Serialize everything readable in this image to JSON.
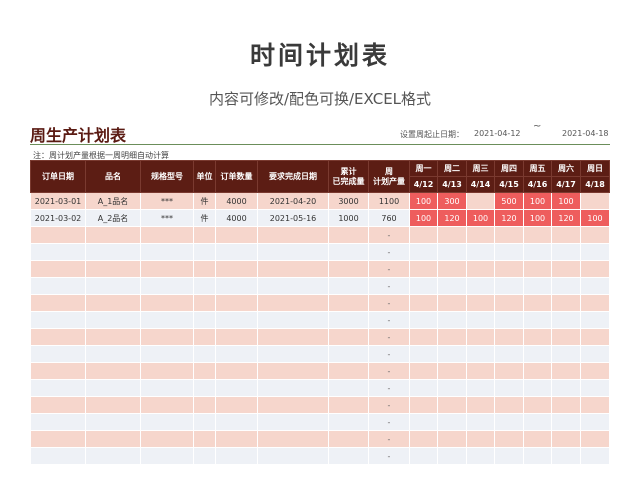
{
  "page": {
    "title": "时间计划表",
    "subtitle": "内容可修改/配色可换/EXCEL格式"
  },
  "sheet": {
    "title": "周生产计划表",
    "period_label": "设置周起止日期：",
    "start_date": "2021-04-12",
    "tilde": "~",
    "end_date": "2021-04-18",
    "note": "注：周计划产量根据一周明细自动计算"
  },
  "columns": {
    "order_date": "订单日期",
    "name": "品名",
    "spec": "规格型号",
    "unit": "单位",
    "order_qty": "订单数量",
    "due_date": "要求完成日期",
    "done_line1": "累计",
    "done_line2": "已完成量",
    "plan_line1": "周",
    "plan_line2": "计划产量",
    "days": [
      {
        "name": "周一",
        "date": "4/12"
      },
      {
        "name": "周二",
        "date": "4/13"
      },
      {
        "name": "周三",
        "date": "4/14"
      },
      {
        "name": "周四",
        "date": "4/15"
      },
      {
        "name": "周五",
        "date": "4/16"
      },
      {
        "name": "周六",
        "date": "4/17"
      },
      {
        "name": "周日",
        "date": "4/18"
      }
    ]
  },
  "rows": [
    {
      "order_date": "2021-03-01",
      "name": "A_1品名",
      "spec": "***",
      "unit": "件",
      "order_qty": "4000",
      "due_date": "2021-04-20",
      "done": "3000",
      "plan": "1100",
      "days": [
        "100",
        "300",
        "",
        "500",
        "100",
        "100",
        ""
      ]
    },
    {
      "order_date": "2021-03-02",
      "name": "A_2品名",
      "spec": "***",
      "unit": "件",
      "order_qty": "4000",
      "due_date": "2021-05-16",
      "done": "1000",
      "plan": "760",
      "days": [
        "100",
        "120",
        "100",
        "120",
        "100",
        "120",
        "100"
      ]
    }
  ],
  "empty_rows": 14,
  "empty_plan_text": "-"
}
